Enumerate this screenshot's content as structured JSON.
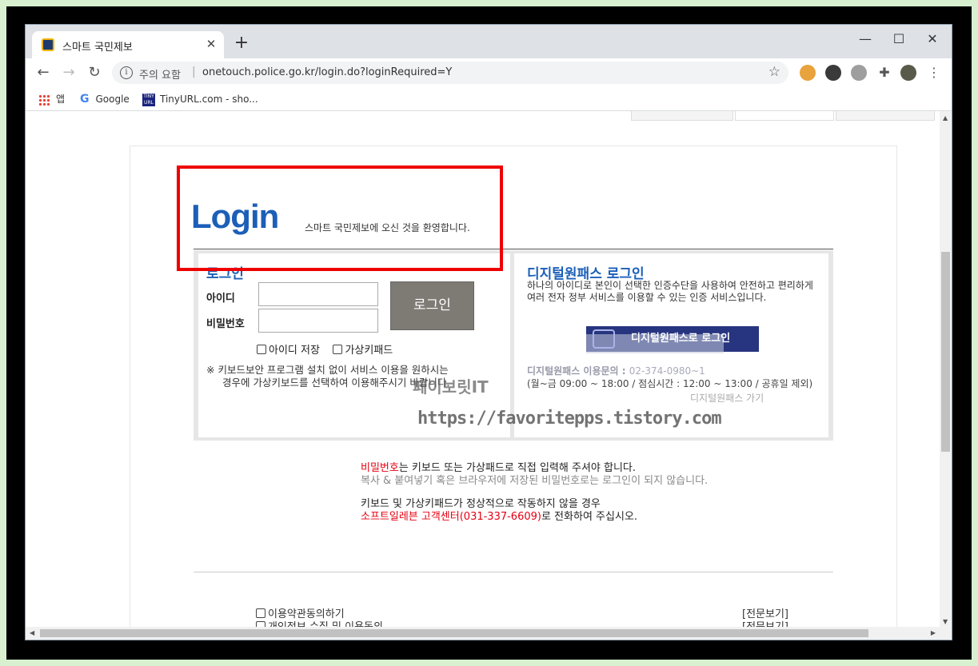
{
  "browser": {
    "tab_title": "스마트 국민제보",
    "new_tab": "+",
    "close_tab": "✕",
    "min": "—",
    "max": "☐",
    "close": "✕",
    "security_text": "주의 요함",
    "url": "onetouch.police.go.kr/login.do?loginRequired=Y",
    "bookmarks": [
      {
        "label": "앱"
      },
      {
        "label": "Google"
      },
      {
        "label": "TinyURL.com - sho..."
      }
    ]
  },
  "login": {
    "title": "Login",
    "welcome": "스마트 국민제보에 오신 것을 환영합니다.",
    "panel_title": "로그인",
    "id_label": "아이디",
    "pw_label": "비밀번호",
    "login_button": "로그인",
    "save_id": "아이디 저장",
    "virtual_keypad": "가상키패드",
    "notice_line1": "※ 키보드보안 프로그램 설치 없이 서비스 이용을 원하시는",
    "notice_line2": "경우에 가상키보드를 선택하여 이용해주시기 바랍니다."
  },
  "digital": {
    "title": "디지털원패스 로그인",
    "desc": "하나의 아이디로 본인이 선택한 인증수단을 사용하여 안전하고 편리하게 여러 전자 정부 서비스를 이용할 수 있는 인증 서비스입니다.",
    "button": "디지털원패스로 로그인",
    "inquiry_label": "디지털원패스 이용문의 : ",
    "inquiry_phone": "02-374-0980~1",
    "hours": "(월~금 09:00 ~ 18:00 / 점심시간 : 12:00 ~ 13:00 / 공휴일 제외)",
    "link": "디지털원패스 가기"
  },
  "watermark": {
    "line1": "페이보릿IT",
    "line2": "https://favoritepps.tistory.com"
  },
  "info": {
    "pw_word": "비밀번호",
    "line1_rest": "는 키보드 또는 가상패드로 직접 입력해 주셔야 합니다.",
    "line2": "복사 & 붙여넣기 혹은 브라우저에 저장된 비밀번호로는 로그인이 되지 않습니다.",
    "line3": "키보드 및 가상키패드가 정상적으로 작동하지 않을 경우",
    "support": "소프트일레븐 고객센터(031-337-6609)",
    "line4_rest": "로 전화하여 주십시오."
  },
  "agreements": [
    {
      "label": "이용약관동의하기",
      "view": "[전문보기]"
    },
    {
      "label": "개인정보 수집 및 이용동의",
      "view": "[전문보기]"
    }
  ]
}
